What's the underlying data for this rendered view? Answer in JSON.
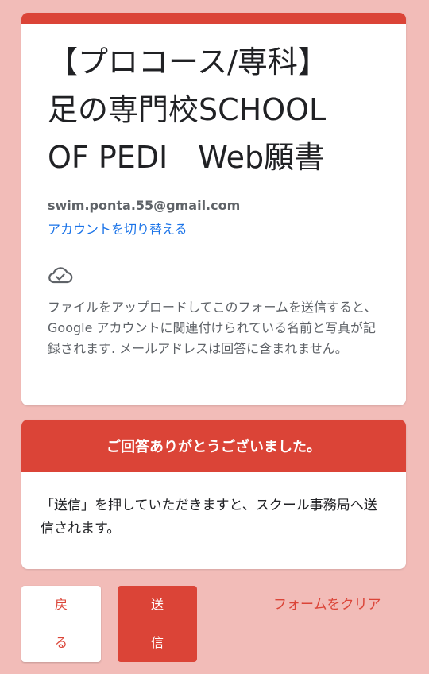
{
  "form": {
    "title_line1": "【プロコース/専科】",
    "title_line2": "足の専門校SCHOOL",
    "title_line3": "OF PEDI　Web願書"
  },
  "account": {
    "email": "swim.ponta.55@gmail.com",
    "switch_label": "アカウントを切り替える"
  },
  "notice": {
    "icon": "cloud-check-icon",
    "text": "ファイルをアップロードしてこのフォームを送信すると、Google アカウントに関連付けられている名前と写真が記録されます. メールアドレスは回答に含まれません。"
  },
  "thanks": {
    "banner": "ご回答ありがとうございました。",
    "body": "「送信」を押していただきますと、スクール事務局へ送信されます。"
  },
  "buttons": {
    "back_line1": "戻",
    "back_line2": "る",
    "submit_line1": "送",
    "submit_line2": "信",
    "clear_form": "フォームをクリア"
  },
  "colors": {
    "accent": "#db4437",
    "background": "#f2bcb8",
    "link": "#1a73e8"
  }
}
